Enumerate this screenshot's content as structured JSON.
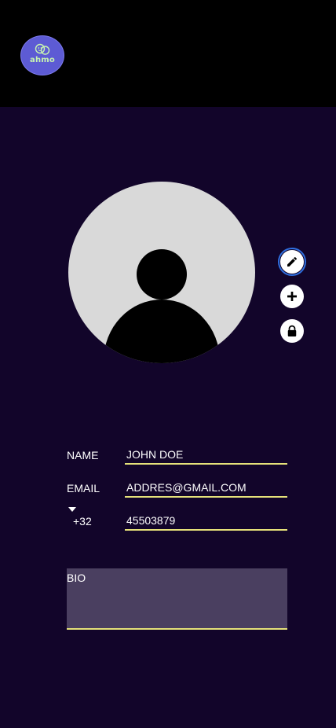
{
  "app": {
    "logo_text": "ahmo",
    "logo_icon": "chat-bubbles-icon"
  },
  "colors": {
    "background": "#12052a",
    "topbar": "#000000",
    "logo_bg": "#5d5bd4",
    "logo_text": "#c8f5b0",
    "underline": "#e6e27a",
    "bio_bg": "#4a3f60",
    "avatar_bg": "#d9d9d9"
  },
  "profile": {
    "avatar_icon": "user-silhouette-icon",
    "actions": [
      {
        "name": "edit",
        "icon": "pencil-icon"
      },
      {
        "name": "add",
        "icon": "plus-icon"
      },
      {
        "name": "lock",
        "icon": "lock-icon"
      }
    ]
  },
  "form": {
    "name_label": "NAME",
    "name_value": "JOHN DOE",
    "email_label": "EMAIL",
    "email_value": "ADDRES@GMAIL.COM",
    "phone_prefix": "+32",
    "phone_value": "45503879",
    "bio_placeholder": "BIO"
  }
}
